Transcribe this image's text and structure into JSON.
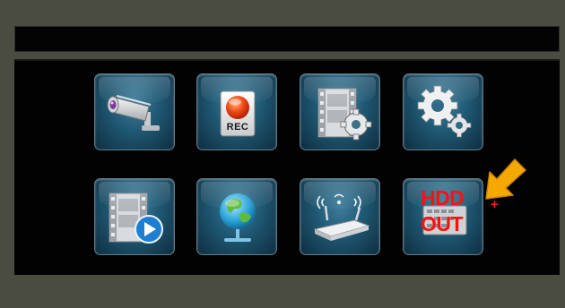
{
  "tiles": [
    {
      "name": "camera",
      "icon": "security-camera-icon"
    },
    {
      "name": "record",
      "icon": "record-button-icon",
      "text": "REC"
    },
    {
      "name": "video-settings",
      "icon": "film-gear-icon"
    },
    {
      "name": "system-settings",
      "icon": "gears-icon"
    },
    {
      "name": "playback",
      "icon": "film-play-icon"
    },
    {
      "name": "network",
      "icon": "globe-icon"
    },
    {
      "name": "wireless",
      "icon": "wifi-router-icon"
    },
    {
      "name": "hdd-out",
      "icon": "hdd-icon"
    }
  ],
  "hdd_annotation": {
    "line1": "HDD",
    "line2": "OUT",
    "color": "#ff1010",
    "stray_mark": "+"
  },
  "pointer_arrow": {
    "icon": "arrow-pointer-icon",
    "color": "#f5a800"
  },
  "colors": {
    "background": "#4a4c42",
    "panel": "#020202",
    "tile_blue": "#1f5873"
  }
}
